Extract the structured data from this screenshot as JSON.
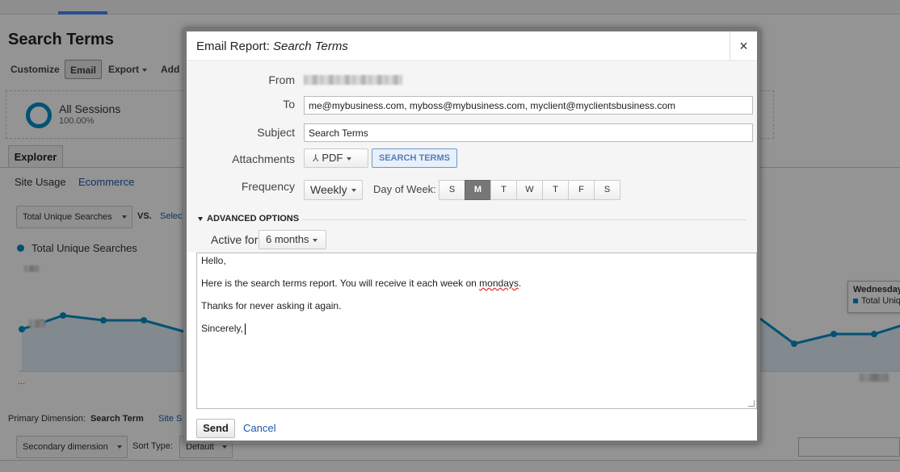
{
  "background": {
    "page_title": "Search Terms",
    "toolbar": {
      "customize": "Customize",
      "email": "Email",
      "export": "Export",
      "add": "Add"
    },
    "segment": {
      "name": "All Sessions",
      "percent": "100.00%"
    },
    "explorer_tab": "Explorer",
    "sub_tabs": {
      "site_usage": "Site Usage",
      "ecommerce": "Ecommerce"
    },
    "metric_select": "Total Unique Searches",
    "vs_label": "VS.",
    "vs_link": "Selec",
    "legend_label": "Total Unique Searches",
    "chart_ellipsis": "...",
    "tooltip": {
      "title": "Wednesday",
      "series": "Total Uniq"
    },
    "primary_dimension": {
      "label": "Primary Dimension:",
      "value": "Search Term",
      "other": "Site S"
    },
    "secondary_dimension": "Secondary dimension",
    "sort_type": {
      "label": "Sort Type:",
      "value": "Default"
    },
    "accent_color": "#058dc7"
  },
  "modal": {
    "title_prefix": "Email Report:",
    "title_report": "Search Terms",
    "close_symbol": "×",
    "labels": {
      "from": "From",
      "to": "To",
      "subject": "Subject",
      "attachments": "Attachments",
      "frequency": "Frequency",
      "day_of_week": "Day of Week:"
    },
    "to_value": "me@mybusiness.com, myboss@mybusiness.com, myclient@myclientsbusiness.com",
    "subject_value": "Search Terms",
    "attachment_format": "PDF",
    "attachment_tag": "SEARCH TERMS",
    "frequency_value": "Weekly",
    "days": [
      "S",
      "M",
      "T",
      "W",
      "T",
      "F",
      "S"
    ],
    "selected_day_index": 1,
    "advanced_options": "ADVANCED OPTIONS",
    "active_for_label": "Active for",
    "active_for_value": "6 months",
    "message": {
      "line1": "Hello,",
      "line2_pre": "Here is the search terms report. You will receive it each week on ",
      "line2_spell": "mondays",
      "line2_post": ".",
      "line3": "Thanks for never asking it again.",
      "line4": "Sincerely,"
    },
    "send_label": "Send",
    "cancel_label": "Cancel",
    "link_color": "#2255aa"
  }
}
